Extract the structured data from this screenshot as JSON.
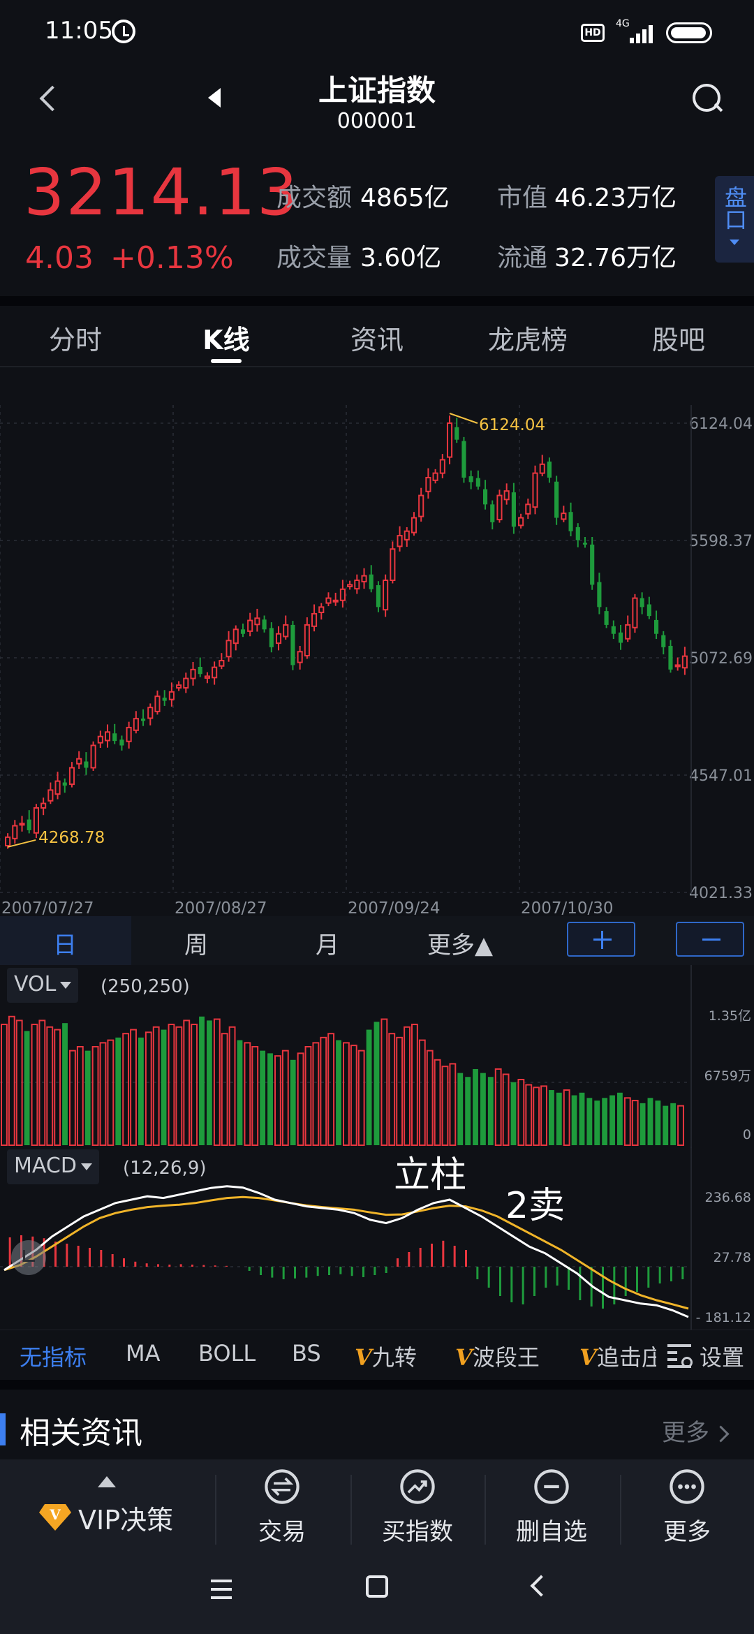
{
  "status_bar": {
    "time": "11:05",
    "hd": "HD",
    "network": "4G"
  },
  "header": {
    "title": "上证指数",
    "code": "000001"
  },
  "quote": {
    "price": "3214.13",
    "change": "4.03",
    "change_pct": "+0.13%",
    "turnover_label": "成交额",
    "turnover_value": "4865亿",
    "volume_label": "成交量",
    "volume_value": "3.60亿",
    "market_cap_label": "市值",
    "market_cap_value": "46.23万亿",
    "float_cap_label": "流通",
    "float_cap_value": "32.76万亿",
    "pankou_label": "盘口"
  },
  "tabs": [
    "分时",
    "K线",
    "资讯",
    "龙虎榜",
    "股吧"
  ],
  "active_tab": 1,
  "periods": {
    "day": "日",
    "week": "周",
    "month": "月",
    "more": "更多▲"
  },
  "colors": {
    "up": "#e8363f",
    "down": "#1e9b3c",
    "accent": "#3d7ff0",
    "ma_white": "#ffffff",
    "ma_yellow": "#f0b429",
    "annotation_yellow": "#f5c242"
  },
  "chart_data": {
    "type": "candlestick",
    "price_axis": [
      "6124.04",
      "5598.37",
      "5072.69",
      "4547.01",
      "4021.33"
    ],
    "ylim": [
      4021.33,
      6124.04
    ],
    "date_ticks": [
      "2007/07/27",
      "2007/08/27",
      "2007/09/24",
      "2007/10/30"
    ],
    "max_label": "6124.04",
    "min_label": "4268.78",
    "closes": [
      4268.78,
      4320,
      4330,
      4300,
      4400,
      4420,
      4480,
      4520,
      4500,
      4580,
      4620,
      4580,
      4680,
      4720,
      4740,
      4700,
      4680,
      4760,
      4800,
      4790,
      4850,
      4900,
      4880,
      4920,
      4950,
      4980,
      5020,
      5000,
      4990,
      5030,
      5060,
      5150,
      5200,
      5180,
      5240,
      5250,
      5200,
      5120,
      5180,
      5220,
      5040,
      5100,
      5220,
      5270,
      5300,
      5340,
      5330,
      5380,
      5400,
      5420,
      5440,
      5380,
      5300,
      5420,
      5560,
      5620,
      5640,
      5700,
      5800,
      5880,
      5900,
      5960,
      6124.04,
      6050,
      5880,
      5860,
      5840,
      5760,
      5680,
      5800,
      5820,
      5660,
      5700,
      5760,
      5900,
      5940,
      5880,
      5700,
      5720,
      5640,
      5600,
      5580,
      5400,
      5300,
      5220,
      5180,
      5140,
      5220,
      5340,
      5300,
      5260,
      5180,
      5120,
      5020,
      5040,
      5080
    ]
  },
  "volume": {
    "selector": "VOL",
    "params": "(250,250)",
    "axis": [
      "1.35亿",
      "6759万",
      "0"
    ],
    "values": [
      0.92,
      0.98,
      0.95,
      0.87,
      0.92,
      0.95,
      0.9,
      0.88,
      0.93,
      0.72,
      0.75,
      0.72,
      0.75,
      0.78,
      0.8,
      0.82,
      0.85,
      0.88,
      0.82,
      0.86,
      0.9,
      0.88,
      0.92,
      0.9,
      0.95,
      0.92,
      0.98,
      0.95,
      0.96,
      0.85,
      0.9,
      0.8,
      0.78,
      0.75,
      0.72,
      0.7,
      0.68,
      0.72,
      0.65,
      0.7,
      0.75,
      0.78,
      0.82,
      0.85,
      0.8,
      0.78,
      0.76,
      0.72,
      0.88,
      0.94,
      0.96,
      0.85,
      0.82,
      0.9,
      0.92,
      0.8,
      0.72,
      0.65,
      0.6,
      0.62,
      0.55,
      0.52,
      0.58,
      0.55,
      0.52,
      0.58,
      0.54,
      0.48,
      0.5,
      0.46,
      0.44,
      0.45,
      0.42,
      0.4,
      0.42,
      0.38,
      0.4,
      0.36,
      0.34,
      0.36,
      0.38,
      0.4,
      0.36,
      0.34,
      0.32,
      0.36,
      0.34,
      0.3,
      0.32,
      0.3
    ]
  },
  "macd": {
    "selector": "MACD",
    "params": "(12,26,9)",
    "axis": [
      "236.68",
      "27.78",
      "- 181.12"
    ],
    "dif": [
      -10,
      20,
      50,
      90,
      120,
      150,
      170,
      190,
      200,
      210,
      205,
      215,
      225,
      235,
      240,
      236,
      220,
      200,
      190,
      180,
      175,
      170,
      160,
      140,
      130,
      145,
      170,
      190,
      200,
      175,
      150,
      120,
      90,
      60,
      40,
      10,
      -20,
      -60,
      -90,
      -100,
      -110,
      -115,
      -130,
      -150
    ],
    "dea": [
      -10,
      5,
      30,
      60,
      90,
      120,
      145,
      160,
      170,
      178,
      182,
      185,
      190,
      198,
      205,
      208,
      205,
      198,
      190,
      183,
      178,
      174,
      170,
      162,
      155,
      156,
      165,
      175,
      182,
      180,
      168,
      150,
      125,
      100,
      75,
      50,
      20,
      -10,
      -40,
      -65,
      -85,
      -100,
      -112,
      -125
    ],
    "hist": [
      0.7,
      0.75,
      0.72,
      0.68,
      0.6,
      0.55,
      0.5,
      0.45,
      0.4,
      0.3,
      0.2,
      0.12,
      0.08,
      0.06,
      0.05,
      0.06,
      0.05,
      0.04,
      0.03,
      0.02,
      0,
      -0.1,
      -0.2,
      -0.26,
      -0.3,
      -0.28,
      -0.26,
      -0.22,
      -0.2,
      -0.18,
      -0.22,
      -0.25,
      -0.2,
      -0.15,
      0.2,
      0.35,
      0.45,
      0.55,
      0.62,
      0.5,
      0.4,
      -0.3,
      -0.5,
      -0.7,
      -0.85,
      -0.9,
      -0.7,
      -0.5,
      -0.45,
      -0.55,
      -0.8,
      -0.95,
      -1.0,
      -0.9,
      -0.7,
      -0.6,
      -0.5,
      -0.4,
      -0.35,
      -0.3
    ]
  },
  "annotations": {
    "lizhu": "立柱",
    "er_mai": "2卖"
  },
  "indicators": [
    "无指标",
    "MA",
    "BOLL",
    "BS",
    "九转",
    "波段王",
    "追击庄"
  ],
  "settings_label": "设置",
  "news": {
    "title": "相关资讯",
    "more": "更多"
  },
  "toolbar": {
    "vip": "VIP决策",
    "trade": "交易",
    "buy_index": "买指数",
    "remove_watch": "删自选",
    "more": "更多"
  }
}
